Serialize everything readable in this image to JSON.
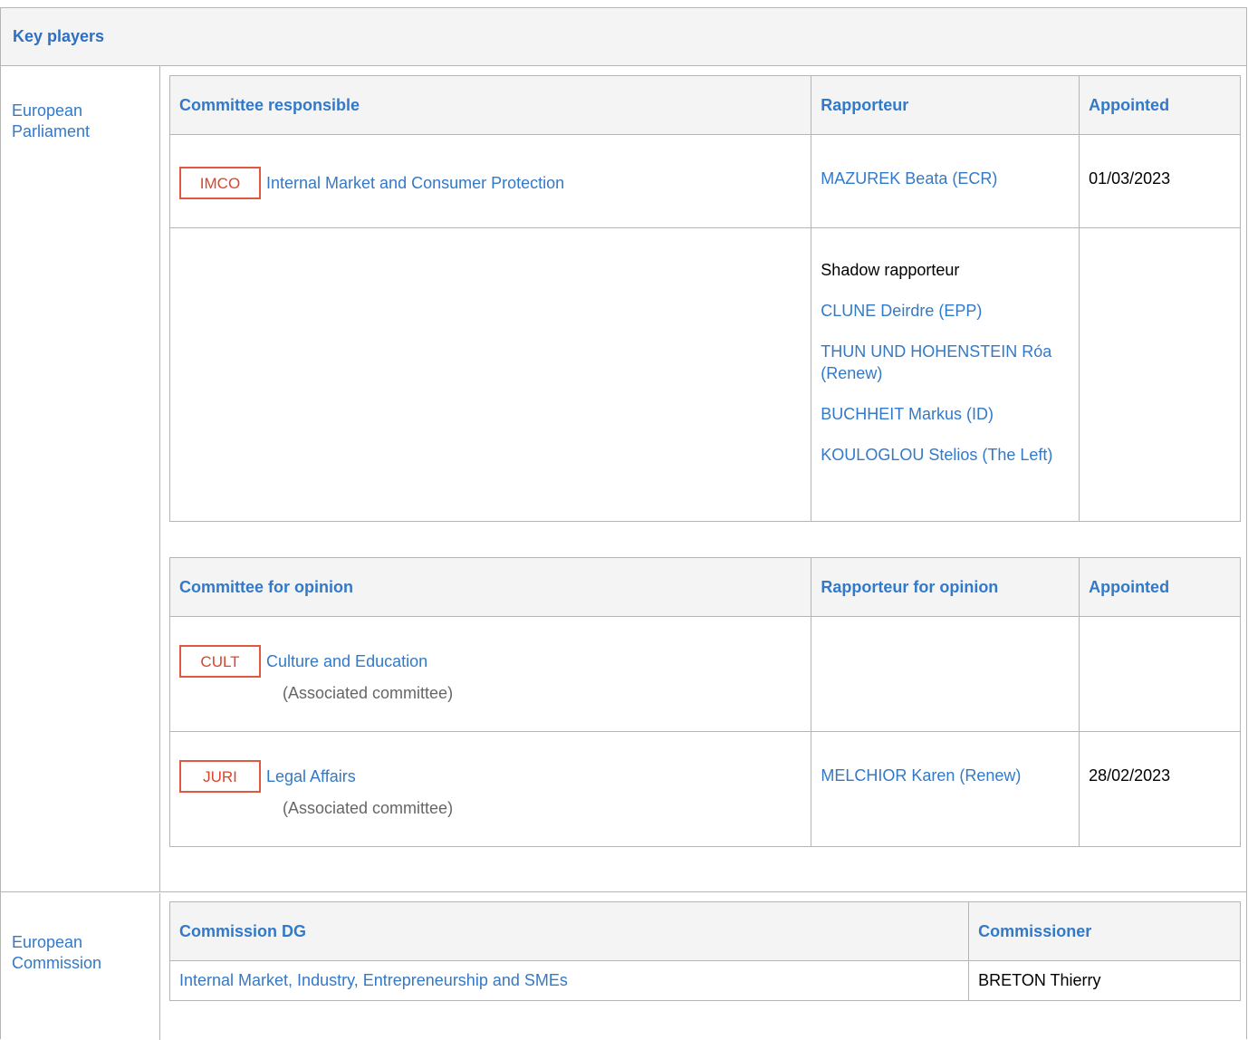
{
  "header": {
    "title": "Key players"
  },
  "ep": {
    "label": "European Parliament",
    "responsible": {
      "headers": [
        "Committee responsible",
        "Rapporteur",
        "Appointed"
      ],
      "committee_code": "IMCO",
      "committee_name": "Internal Market and Consumer Protection",
      "rapporteur": "MAZUREK Beata (ECR)",
      "appointed": "01/03/2023",
      "shadow_label": "Shadow rapporteur",
      "shadows": [
        "CLUNE Deirdre (EPP)",
        "THUN UND HOHENSTEIN Róa (Renew)",
        "BUCHHEIT Markus (ID)",
        "KOULOGLOU Stelios (The Left)"
      ]
    },
    "opinion": {
      "headers": [
        "Committee for opinion",
        "Rapporteur for opinion",
        "Appointed"
      ],
      "rows": [
        {
          "code": "CULT",
          "name": "Culture and Education",
          "note": "(Associated committee)",
          "rapporteur": "",
          "appointed": ""
        },
        {
          "code": "JURI",
          "name": "Legal Affairs",
          "note": "(Associated committee)",
          "rapporteur": "MELCHIOR Karen (Renew)",
          "appointed": "28/02/2023"
        }
      ]
    }
  },
  "ec": {
    "label": "European Commission",
    "headers": [
      "Commission DG",
      "Commissioner"
    ],
    "dg": "Internal Market, Industry, Entrepreneurship and SMEs",
    "commissioner": "BRETON Thierry"
  }
}
